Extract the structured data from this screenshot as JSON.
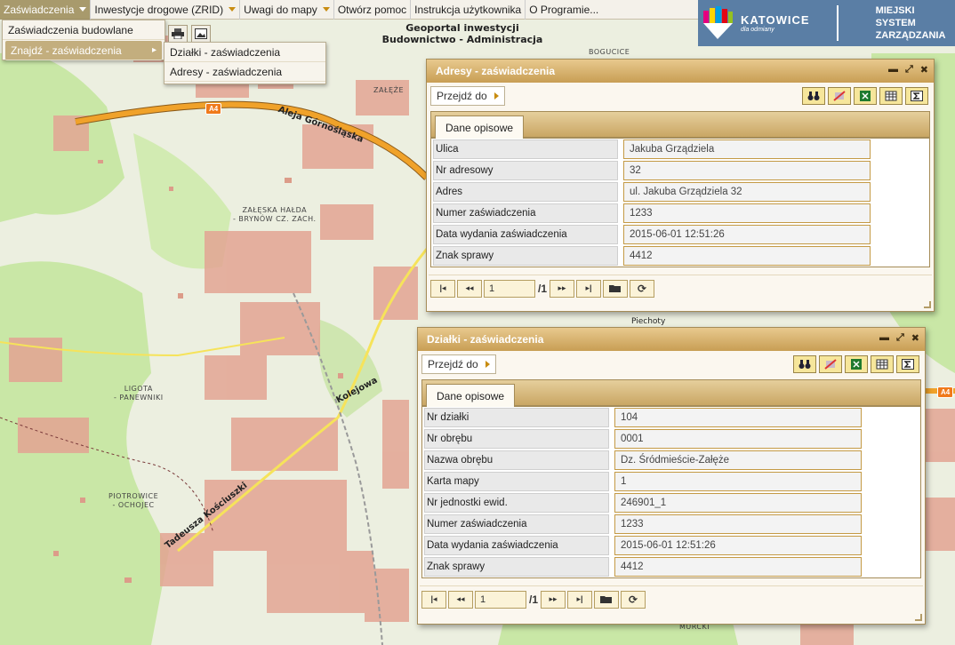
{
  "topbar": {
    "items": [
      {
        "label": "Zaświadczenia",
        "has_caret": true
      },
      {
        "label": "Inwestycje drogowe (ZRID)",
        "has_caret": true
      },
      {
        "label": "Uwagi do mapy",
        "has_caret": true
      },
      {
        "label": "Otwórz pomoc",
        "has_caret": false
      },
      {
        "label": "Instrukcja użytkownika",
        "has_caret": false
      },
      {
        "label": "O Programie...",
        "has_caret": false
      }
    ]
  },
  "dropdown1": {
    "items": [
      {
        "label": "Zaświadczenia budowlane"
      },
      {
        "label": "Znajdź - zaświadczenia"
      }
    ]
  },
  "dropdown2": {
    "items": [
      {
        "label": "Działki - zaświadczenia"
      },
      {
        "label": "Adresy - zaświadczenia"
      }
    ]
  },
  "geo_title": {
    "line1": "Geoportal inwestycji",
    "line2": "Budownictwo - Administracja"
  },
  "logo": {
    "city": "KATOWICE",
    "tagline": "dla odmiany",
    "system_line1": "MIEJSKI",
    "system_line2": "SYSTEM",
    "system_line3": "ZARZĄDZANIA"
  },
  "map_labels": {
    "bogucice": "BOGUCICE",
    "zaleze": "ZAŁĘŻE",
    "zaleska1": "ZAŁĘSKA HAŁDA",
    "zaleska2": "- BRYNÓW CZ. ZACH.",
    "ligota1": "LIGOTA",
    "ligota2": "- PANEWNIKI",
    "piotrowice1": "PIOTROWICE",
    "piotrowice2": "- OCHOJEC",
    "murcki": "MURCKI",
    "aleja": "Aleja Górnośląska",
    "kolejowa": "Kolejowa",
    "kosciuszki": "Tadeusza Kościuszki",
    "piechoty": "Piechoty",
    "a4_badge": "A4"
  },
  "win_adresy": {
    "title": "Adresy - zaświadczenia",
    "przejdz": "Przejdź do",
    "tab": "Dane opisowe",
    "rows": [
      {
        "label": "Ulica",
        "value": "Jakuba Grządziela"
      },
      {
        "label": "Nr adresowy",
        "value": "32"
      },
      {
        "label": "Adres",
        "value": "ul. Jakuba Grządziela 32"
      },
      {
        "label": "Numer zaświadczenia",
        "value": "1233"
      },
      {
        "label": "Data wydania zaświadczenia",
        "value": "2015-06-01 12:51:26"
      },
      {
        "label": "Znak sprawy",
        "value": "4412"
      }
    ],
    "page": "1",
    "total": "/1"
  },
  "win_dzialki": {
    "title": "Działki - zaświadczenia",
    "przejdz": "Przejdź do",
    "tab": "Dane opisowe",
    "rows": [
      {
        "label": "Nr działki",
        "value": "104"
      },
      {
        "label": "Nr obrębu",
        "value": "0001"
      },
      {
        "label": "Nazwa obrębu",
        "value": "Dz. Śródmieście-Załęże"
      },
      {
        "label": "Karta mapy",
        "value": "1"
      },
      {
        "label": "Nr jednostki ewid.",
        "value": "246901_1"
      },
      {
        "label": "Numer zaświadczenia",
        "value": "1233"
      },
      {
        "label": "Data wydania zaświadczenia",
        "value": "2015-06-01 12:51:26"
      },
      {
        "label": "Znak sprawy",
        "value": "4412"
      }
    ],
    "page": "1",
    "total": "/1"
  },
  "colors": {
    "accent": "#c89e54",
    "menu_active": "#a89a6c",
    "logo_bg": "#5a7ea5",
    "park_green": "#c9e7a6",
    "building": "#e3a493",
    "motorway": "#f0a22a"
  }
}
